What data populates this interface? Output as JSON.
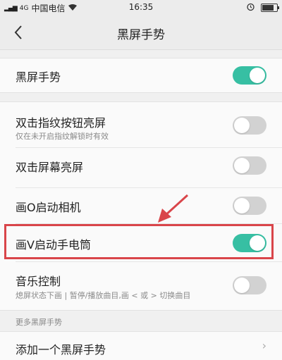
{
  "status_bar": {
    "carrier": "中国电信",
    "signal_label": "4G",
    "time": "16:35"
  },
  "header": {
    "title": "黑屏手势"
  },
  "master_toggle": {
    "label": "黑屏手势",
    "on": true
  },
  "gestures": [
    {
      "label": "双击指纹按钮亮屏",
      "sub": "仅在未开启指纹解锁时有效",
      "on": false
    },
    {
      "label": "双击屏幕亮屏",
      "on": false
    },
    {
      "label": "画O启动相机",
      "on": false
    },
    {
      "label": "画V启动手电筒",
      "on": true
    },
    {
      "label": "音乐控制",
      "sub": "熄屏状态下画 | 暂停/播放曲目,画 < 或 > 切换曲目",
      "on": false
    }
  ],
  "more_section": {
    "header": "更多黑屏手势",
    "add_label": "添加一个黑屏手势"
  },
  "colors": {
    "toggle_on": "#37bfa3",
    "toggle_off": "#d2d2d2",
    "highlight": "#d9454a"
  }
}
